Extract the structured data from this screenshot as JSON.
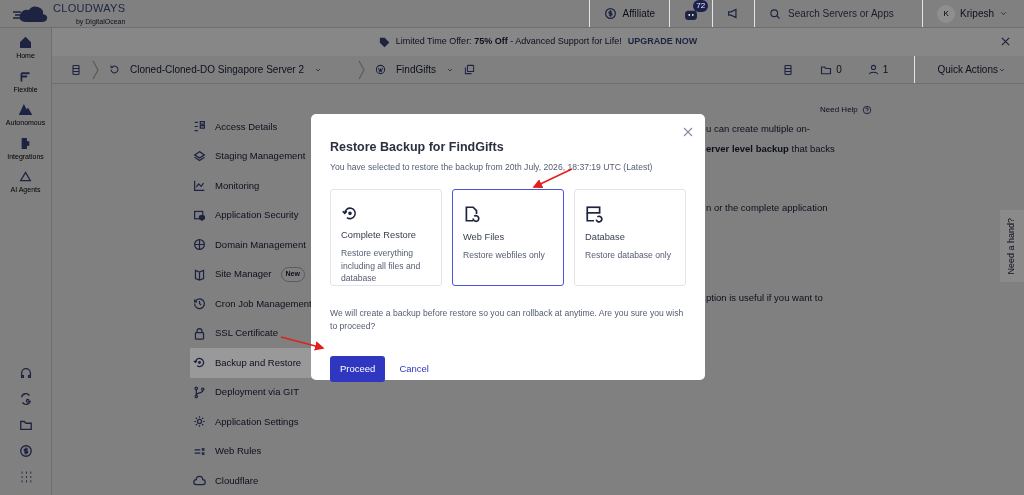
{
  "header": {
    "logo_text": "CLOUDWAYS",
    "logo_sub": "by DigitalOcean",
    "affiliate": "Affiliate",
    "notification_count": "72",
    "search": {
      "placeholder": "Search Servers or Apps"
    },
    "user": {
      "initial": "K",
      "name": "Kripesh"
    }
  },
  "sidebar": {
    "items": [
      {
        "label": "Home"
      },
      {
        "label": "Flexible"
      },
      {
        "label": "Autonomous"
      },
      {
        "label": "Integrations"
      },
      {
        "label": "AI Agents"
      }
    ]
  },
  "banner": {
    "text": "Limited Time Offer: **75% Off** - Advanced Support for Life!",
    "link": "UPGRADE NOW"
  },
  "breadcrumb": {
    "server": "Cloned-Cloned-DO Singapore Server 2",
    "app": "FindGifts",
    "folders": "0",
    "users": "1",
    "quick_actions": "Quick Actions"
  },
  "app_menu": {
    "items": [
      {
        "label": "Access Details",
        "selected": false
      },
      {
        "label": "Staging Management",
        "selected": false
      },
      {
        "label": "Monitoring",
        "selected": false
      },
      {
        "label": "Application Security",
        "selected": false
      },
      {
        "label": "Domain Management",
        "selected": false
      },
      {
        "label": "Site Manager",
        "badge": "New",
        "selected": false
      },
      {
        "label": "Cron Job Management",
        "selected": false
      },
      {
        "label": "SSL Certificate",
        "selected": false
      },
      {
        "label": "Backup and Restore",
        "selected": true
      },
      {
        "label": "Deployment via GIT",
        "selected": false
      },
      {
        "label": "Application Settings",
        "selected": false
      },
      {
        "label": "Web Rules",
        "selected": false
      },
      {
        "label": "Cloudflare",
        "selected": false
      }
    ]
  },
  "need_help": "Need Help",
  "content_fragments": [
    "u can create multiple on-",
    "**erver level backup** that backs",
    "n or the complete application",
    "ption is useful if you want to"
  ],
  "help_tab": "Need a hand?",
  "modal": {
    "title": "Restore Backup for FindGifts",
    "subtitle": "You have selected to restore the backup from 20th July, 2026, 18:37:19 UTC (Latest)",
    "options": [
      {
        "title": "Complete Restore",
        "description": "Restore everything including all files and database",
        "selected": false
      },
      {
        "title": "Web Files",
        "description": "Restore webfiles only",
        "selected": true
      },
      {
        "title": "Database",
        "description": "Restore database only",
        "selected": false
      }
    ],
    "note": "We will create a backup before restore so you can rollback at anytime. Are you sure you wish to proceed?",
    "primary_button": "Proceed",
    "secondary_button": "Cancel"
  }
}
